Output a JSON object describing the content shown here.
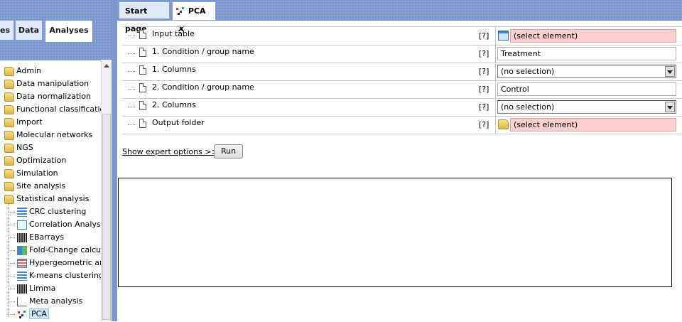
{
  "left_panel": {
    "tabs": [
      "es",
      "Data",
      "Analyses"
    ],
    "active_tab": "Analyses",
    "tree": [
      {
        "label": "Admin",
        "type": "folder"
      },
      {
        "label": "Data manipulation",
        "type": "folder"
      },
      {
        "label": "Data normalization",
        "type": "folder"
      },
      {
        "label": "Functional classification",
        "type": "folder"
      },
      {
        "label": "Import",
        "type": "folder"
      },
      {
        "label": "Molecular networks",
        "type": "folder"
      },
      {
        "label": "NGS",
        "type": "folder"
      },
      {
        "label": "Optimization",
        "type": "folder"
      },
      {
        "label": "Simulation",
        "type": "folder"
      },
      {
        "label": "Site analysis",
        "type": "folder"
      },
      {
        "label": "Statistical analysis",
        "type": "folder"
      },
      {
        "label": "CRC clustering",
        "type": "leaf"
      },
      {
        "label": "Correlation Analysis",
        "type": "leaf"
      },
      {
        "label": "EBarrays",
        "type": "leaf"
      },
      {
        "label": "Fold-Change calcula",
        "type": "leaf"
      },
      {
        "label": "Hypergeometric ana",
        "type": "leaf"
      },
      {
        "label": "K-means clustering",
        "type": "leaf"
      },
      {
        "label": "Limma",
        "type": "leaf"
      },
      {
        "label": "Meta analysis",
        "type": "leaf"
      },
      {
        "label": "PCA",
        "type": "leaf",
        "selected": true
      }
    ]
  },
  "tabs": {
    "start_page": "Start page",
    "pca": "PCA",
    "close": "x"
  },
  "form": {
    "help": "[?]",
    "rows": [
      {
        "label": "Input table",
        "value": "(select element)",
        "kind": "pink-table"
      },
      {
        "label": "1. Condition / group name",
        "value": "Treatment",
        "kind": "text"
      },
      {
        "label": "1. Columns",
        "value": "(no selection)",
        "kind": "select"
      },
      {
        "label": "2. Condition / group name",
        "value": "Control",
        "kind": "text"
      },
      {
        "label": "2. Columns",
        "value": "(no selection)",
        "kind": "select"
      },
      {
        "label": "Output folder",
        "value": "(select element)",
        "kind": "pink-folder"
      }
    ]
  },
  "actions": {
    "expert": "Show expert options >>",
    "run": "Run"
  },
  "colors": {
    "header_blue": "#7d97cf",
    "pink_field": "#ffcfcf"
  }
}
